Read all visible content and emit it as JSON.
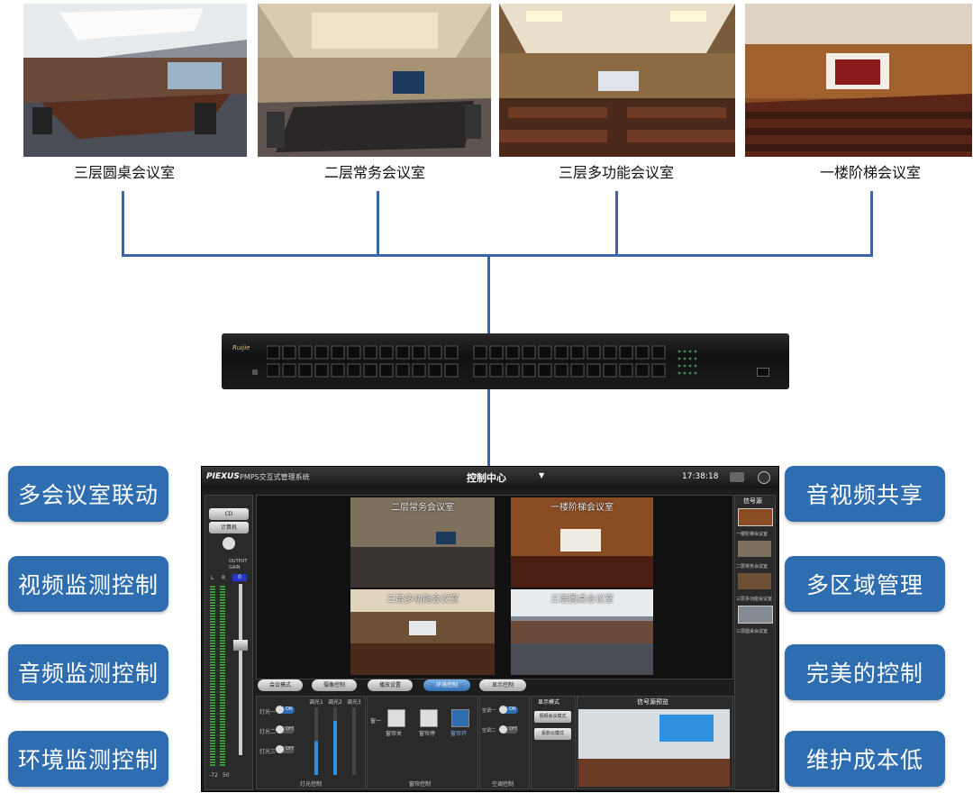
{
  "rooms": [
    {
      "label": "三层圆桌会议室"
    },
    {
      "label": "二层常务会议室"
    },
    {
      "label": "三层多功能会议室"
    },
    {
      "label": "一楼阶梯会议室"
    }
  ],
  "features_left": [
    "多会议室联动",
    "视频监测控制",
    "音频监测控制",
    "环境监测控制"
  ],
  "features_right": [
    "音视频共享",
    "多区域管理",
    "完美的控制",
    "维护成本低"
  ],
  "switch": {
    "brand": "Ruijie"
  },
  "control": {
    "logo": "PIEXUS",
    "system_name": "PMPS交互式管理系统",
    "center_title": "控制中心",
    "time": "17:38:18",
    "signal_source_title": "信号源",
    "source_items": [
      "一楼阶梯会议室",
      "二层常务会议室",
      "三层多功能会议室",
      "三层圆桌会议室"
    ],
    "audio": {
      "select1": "CD",
      "select2": "计算机",
      "output_gain": "OUTPUT GAIN",
      "gain_value": "0",
      "l": "L",
      "r": "R",
      "min": "-72",
      "max": "50"
    },
    "cameras": [
      "二层常务会议室",
      "一楼阶梯会议室",
      "三层多功能会议室",
      "三层圆桌会议室"
    ],
    "mode_buttons": [
      "会议模式",
      "摄像控制",
      "播放设置",
      "环境控制",
      "显示控制"
    ],
    "lights": {
      "items": [
        "灯光一",
        "灯光二",
        "灯光三"
      ],
      "states": [
        "ON",
        "OFF",
        "OFF"
      ],
      "dimmers": [
        "调光1",
        "调光2",
        "调光3"
      ],
      "section": "灯光控制"
    },
    "curtain": {
      "row": "窗一",
      "items": [
        "窗帘关",
        "窗帘停",
        "窗帘开"
      ],
      "section": "窗帘控制"
    },
    "ac": {
      "items": [
        "空调一",
        "空调二"
      ],
      "states": [
        "ON",
        "OFF"
      ],
      "section": "空调控制"
    },
    "display_mode": {
      "title": "显示模式",
      "items": [
        "视频会议模式",
        "投影仪模式"
      ]
    },
    "preview": {
      "title": "信号源预览"
    }
  }
}
